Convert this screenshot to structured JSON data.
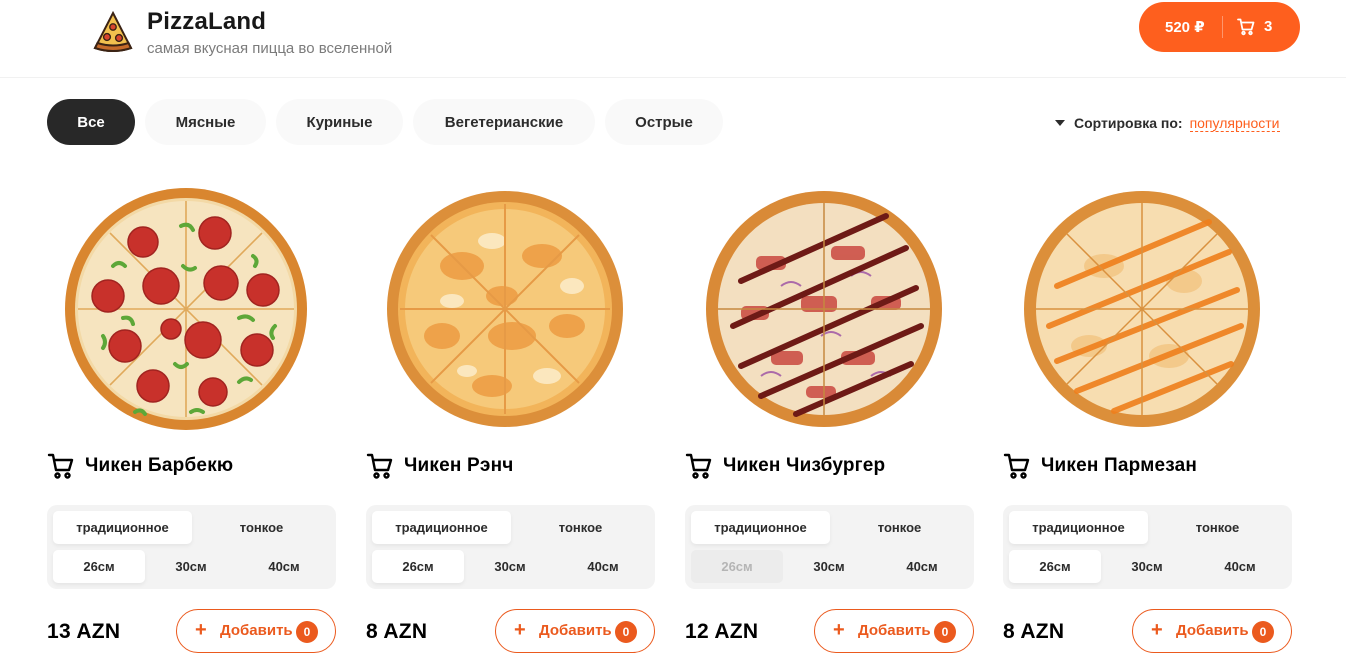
{
  "header": {
    "logo_icon": "pizza-slice-icon",
    "title": "PizzaLand",
    "subtitle": "самая вкусная пицца во вселенной",
    "cart": {
      "price": "520 ₽",
      "count": "3",
      "icon": "cart-icon"
    }
  },
  "categories": [
    {
      "label": "Все",
      "active": true
    },
    {
      "label": "Мясные",
      "active": false
    },
    {
      "label": "Куриные",
      "active": false
    },
    {
      "label": "Вегетерианские",
      "active": false
    },
    {
      "label": "Острые",
      "active": false
    }
  ],
  "sort": {
    "label": "Сортировка по:",
    "value": "популярности",
    "icon": "caret-down-icon"
  },
  "pizzas": [
    {
      "name": "Чикен Барбекю",
      "image": "pizza-pepperoni-image",
      "dough": [
        {
          "label": "традиционное",
          "selected": true
        },
        {
          "label": "тонкое",
          "selected": false
        }
      ],
      "sizes": [
        {
          "label": "26см",
          "selected": true
        },
        {
          "label": "30см",
          "selected": false
        },
        {
          "label": "40см",
          "selected": false
        }
      ],
      "price": "13 AZN",
      "add_label": "Добавить",
      "add_count": "0"
    },
    {
      "name": "Чикен Рэнч",
      "image": "pizza-cheese-image",
      "dough": [
        {
          "label": "традиционное",
          "selected": true
        },
        {
          "label": "тонкое",
          "selected": false
        }
      ],
      "sizes": [
        {
          "label": "26см",
          "selected": true
        },
        {
          "label": "30см",
          "selected": false
        },
        {
          "label": "40см",
          "selected": false
        }
      ],
      "price": "8 AZN",
      "add_label": "Добавить",
      "add_count": "0"
    },
    {
      "name": "Чикен Чизбургер",
      "image": "pizza-bbq-image",
      "dough": [
        {
          "label": "традиционное",
          "selected": true
        },
        {
          "label": "тонкое",
          "selected": false
        }
      ],
      "sizes": [
        {
          "label": "26см",
          "selected": false,
          "disabled": true
        },
        {
          "label": "30см",
          "selected": false
        },
        {
          "label": "40см",
          "selected": false
        }
      ],
      "price": "12 AZN",
      "add_label": "Добавить",
      "add_count": "0"
    },
    {
      "name": "Чикен Пармезан",
      "image": "pizza-sauce-image",
      "dough": [
        {
          "label": "традиционное",
          "selected": true
        },
        {
          "label": "тонкое",
          "selected": false
        }
      ],
      "sizes": [
        {
          "label": "26см",
          "selected": true
        },
        {
          "label": "30см",
          "selected": false
        },
        {
          "label": "40см",
          "selected": false
        }
      ],
      "price": "8 AZN",
      "add_label": "Добавить",
      "add_count": "0"
    }
  ],
  "colors": {
    "accent": "#fe5f1e",
    "active_category": "#282828",
    "selector_bg": "#f3f3f3"
  }
}
